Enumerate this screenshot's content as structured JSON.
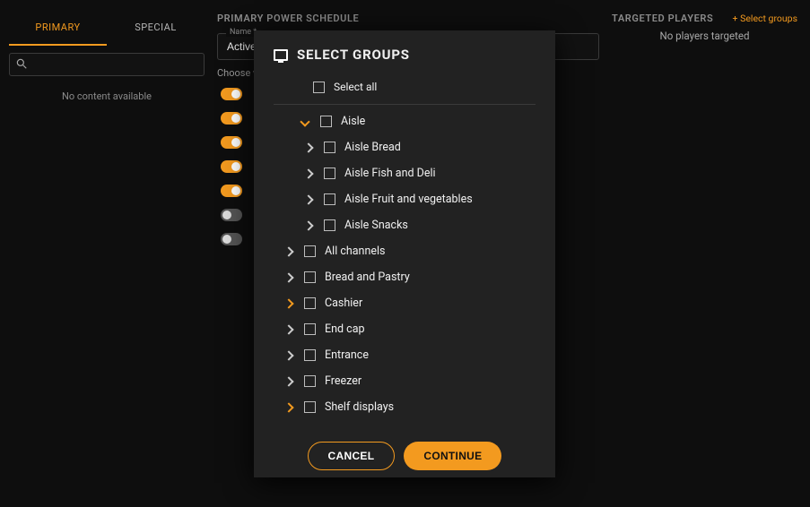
{
  "left": {
    "tabs": {
      "primary": "PRIMARY",
      "special": "SPECIAL"
    },
    "search_placeholder": "",
    "no_content": "No content available"
  },
  "mid": {
    "title": "PRIMARY POWER SCHEDULE",
    "name_label": "Name *",
    "name_value": "Active Hours",
    "choose_text": "Choose which days to apply the power schedule",
    "toggles_state": [
      "on",
      "on",
      "on",
      "on",
      "on",
      "off",
      "off"
    ]
  },
  "right": {
    "title": "TARGETED PLAYERS",
    "link": "+ Select groups",
    "empty": "No players targeted"
  },
  "modal": {
    "title": "SELECT GROUPS",
    "select_all": "Select all",
    "cancel": "CANCEL",
    "continue": "CONTINUE",
    "tree": [
      {
        "label": "Aisle",
        "expanded": true,
        "highlight": true,
        "children": [
          {
            "label": "Aisle Bread"
          },
          {
            "label": "Aisle Fish and Deli"
          },
          {
            "label": "Aisle Fruit and vegetables"
          },
          {
            "label": "Aisle Snacks"
          }
        ]
      },
      {
        "label": "All channels"
      },
      {
        "label": "Bread and Pastry"
      },
      {
        "label": "Cashier",
        "highlight": true
      },
      {
        "label": "End cap"
      },
      {
        "label": "Entrance"
      },
      {
        "label": "Freezer"
      },
      {
        "label": "Shelf displays",
        "highlight": true
      }
    ]
  }
}
